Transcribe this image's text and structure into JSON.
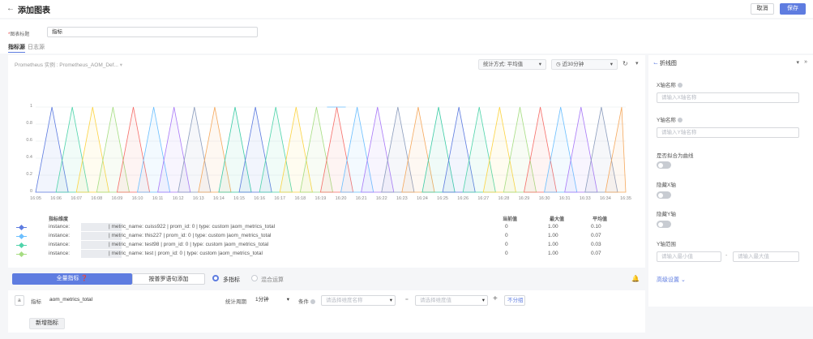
{
  "header": {
    "back_icon": "←",
    "title": "添加图表",
    "cancel_label": "取消",
    "save_label": "保存"
  },
  "form": {
    "title_label": "图表标题",
    "title_required": "*",
    "title_value": "指标"
  },
  "tabs": [
    "指标源",
    "日志源"
  ],
  "toolbar": {
    "instance_label": "Prometheus 实例 : Prometheus_AOM_Def...",
    "stat_method": "统计方式: 平均值",
    "time_range": "近30分钟",
    "chart_type": "折线图"
  },
  "chart_data": {
    "type": "line",
    "x": [
      "16:05",
      "16:06",
      "16:07",
      "16:08",
      "16:09",
      "16:10",
      "16:11",
      "16:12",
      "16:13",
      "16:14",
      "16:15",
      "16:16",
      "16:17",
      "16:18",
      "16:19",
      "16:20",
      "16:21",
      "16:22",
      "16:23",
      "16:24",
      "16:25",
      "16:26",
      "16:27",
      "16:28",
      "16:29",
      "16:30",
      "16:31",
      "16:33",
      "16:34",
      "16:35"
    ],
    "yticks": [
      "0",
      "0.2",
      "0.4",
      "0.6",
      "0.8",
      "1"
    ],
    "ylim": [
      0,
      1
    ],
    "colors": [
      "#5e7ce0",
      "#50d4ab",
      "#fbd444",
      "#a6dd82",
      "#f66f6a",
      "#6cbfff",
      "#a97af8",
      "#8c9dbd",
      "#f5a95e",
      "#3dcca6"
    ],
    "grid": true
  },
  "table": {
    "headers": {
      "dimension": "指标维度",
      "current": "当前值",
      "max": "最大值",
      "avg": "平均值"
    },
    "rows": [
      {
        "instance": "instance:",
        "rest": "| metric_name: cuiss922 | prom_id: 0 | type: custom |aom_metrics_total",
        "current": "0",
        "max": "1.00",
        "avg": "0.10",
        "color": "#5e7ce0"
      },
      {
        "instance": "instance:",
        "rest": "| metric_name: this227 | prom_id: 0 | type: custom |aom_metrics_total",
        "current": "0",
        "max": "1.00",
        "avg": "0.07",
        "color": "#6cbfff"
      },
      {
        "instance": "instance:",
        "rest": "| metric_name: test98 | prom_id: 0 | type: custom |aom_metrics_total",
        "current": "0",
        "max": "1.00",
        "avg": "0.03",
        "color": "#50d4ab"
      },
      {
        "instance": "instance:",
        "rest": "| metric_name: test | prom_id: 0 | type: custom |aom_metrics_total",
        "current": "0",
        "max": "1.00",
        "avg": "0.07",
        "color": "#a6dd82"
      }
    ]
  },
  "query": {
    "all_metrics": "全量指标",
    "prom_add": "按普罗语句添加",
    "multi_metric": "多指标",
    "mixed_op": "混合运算",
    "row_letter": "a",
    "metric_label": "指标",
    "metric_value": "aom_metrics_total",
    "period_label": "统计周期",
    "period_value": "1分钟",
    "cond_label": "条件",
    "cond_dim_ph": "请选择维度名称",
    "cond_eq": "=",
    "cond_val_ph": "请选择维度值",
    "plus": "+",
    "no_group": "不分组",
    "add_metric": "新增指标"
  },
  "side": {
    "xaxis_label": "X轴名称",
    "xaxis_ph": "请输入X轴名称",
    "yaxis_label": "Y轴名称",
    "yaxis_ph": "请输入Y轴名称",
    "percent_label": "是否拟合为曲线",
    "hide_x": "隐藏X轴",
    "hide_y": "隐藏Y轴",
    "yrange_label": "Y轴范围",
    "ymin_ph": "请输入最小值",
    "ymax_ph": "请输入最大值",
    "range_sep": "-",
    "advanced": "高级设置"
  }
}
